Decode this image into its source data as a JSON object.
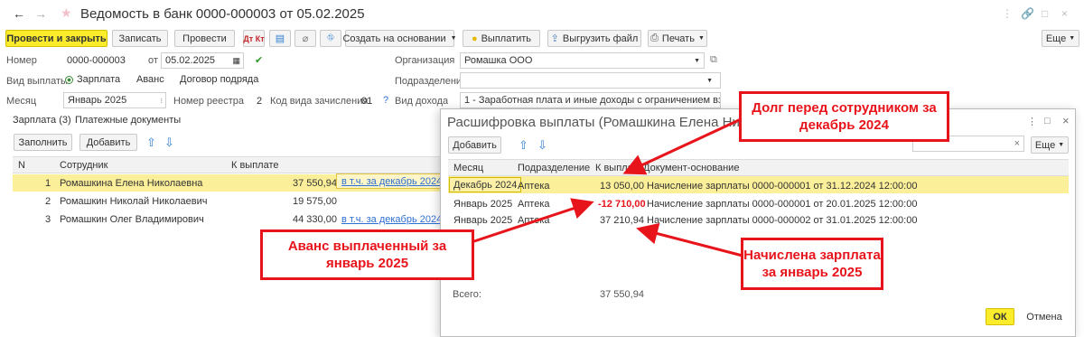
{
  "window": {
    "title": "Ведомость в банк 0000-000003 от 05.02.2025",
    "back_icon": "arrow-left-icon",
    "forward_icon": "arrow-right-icon",
    "favorite_icon": "star-icon",
    "controls": [
      "⋮",
      "🔗",
      "□",
      "×"
    ]
  },
  "toolbar": {
    "post_close": "Провести и закрыть",
    "save": "Записать",
    "post": "Провести",
    "create_based": "Создать на основании",
    "pay": "Выплатить",
    "upload": "Выгрузить файл",
    "print": "Печать",
    "more": "Еще"
  },
  "form": {
    "number_label": "Номер",
    "number_value": "0000-000003",
    "date_label": "от",
    "date_value": "05.02.2025",
    "org_label": "Организация",
    "org_value": "Ромашка ООО",
    "pay_type_label": "Вид выплаты",
    "pay_type_options": [
      "Зарплата",
      "Аванс",
      "Договор подряда"
    ],
    "subdivision_label": "Подразделение",
    "subdivision_value": "",
    "month_label": "Месяц",
    "month_value": "Январь 2025",
    "registry_label": "Номер реестра",
    "registry_value": "2",
    "code_label": "Код вида зачисления",
    "code_value": "01",
    "income_label": "Вид дохода",
    "income_value": "1 - Заработная плата и иные доходы с ограничением взыскан"
  },
  "tabs": {
    "salary": "Зарплата (3)",
    "payments": "Платежные документы"
  },
  "main_table": {
    "fill_button": "Заполнить",
    "add_button": "Добавить",
    "headers": [
      "N",
      "Сотрудник",
      "К выплате"
    ],
    "rows": [
      {
        "n": "1",
        "employee": "Ромашкина Елена Николаевна",
        "amount": "37 550,94",
        "link": "в т.ч. за декабрь 2024"
      },
      {
        "n": "2",
        "employee": "Ромашкин Николай Николаевич",
        "amount": "19 575,00",
        "link": ""
      },
      {
        "n": "3",
        "employee": "Ромашкин Олег Владимирович",
        "amount": "44 330,00",
        "link": "в т.ч. за декабрь 2024"
      }
    ]
  },
  "dialog": {
    "title": "Расшифровка выплаты (Ромашкина Елена Николаевна)",
    "add_button": "Добавить",
    "more": "Еще",
    "headers": [
      "Месяц",
      "Подразделение",
      "К выплате",
      "Документ-основание"
    ],
    "rows": [
      {
        "month": "Декабрь 2024",
        "dept": "Аптека",
        "amount": "13 050,00",
        "doc": "Начисление зарплаты 0000-000001 от 31.12.2024 12:00:00"
      },
      {
        "month": "Январь 2025",
        "dept": "Аптека",
        "amount": "-12 710,00",
        "doc": "Начисление зарплаты 0000-000001 от 20.01.2025 12:00:00"
      },
      {
        "month": "Январь 2025",
        "dept": "Аптека",
        "amount": "37 210,94",
        "doc": "Начисление зарплаты 0000-000002 от 31.01.2025 12:00:00"
      }
    ],
    "total_label": "Всего:",
    "total_value": "37 550,94",
    "ok": "ОК",
    "cancel": "Отмена"
  },
  "callouts": {
    "debt": "Долг перед сотрудником за декабрь 2024",
    "advance": "Аванс выплаченный за январь 2025",
    "salary": "Начислена зарплата за январь 2025"
  },
  "colors": {
    "accent_yellow": "#fbed2c",
    "selected_row": "#fbef9a",
    "annotation_red": "#e8141b",
    "negative_red": "#e8141b",
    "link_blue": "#2d6fd2"
  }
}
